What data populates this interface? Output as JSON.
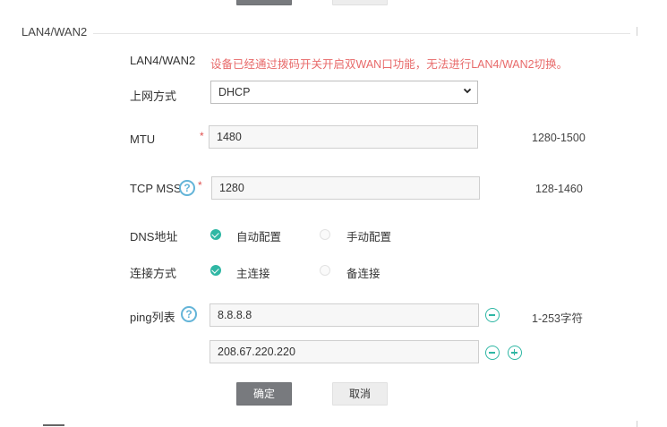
{
  "top_buttons": {
    "confirm_label": "",
    "cancel_label": ""
  },
  "section": {
    "title": "LAN4/WAN2"
  },
  "lan_wan": {
    "label": "LAN4/WAN2",
    "warning": "设备已经通过拨码开关开启双WAN口功能，无法进行LAN4/WAN2切换。"
  },
  "wan_mode": {
    "label": "上网方式",
    "value": "DHCP"
  },
  "mtu": {
    "label": "MTU",
    "required_mark": "*",
    "value": "1480",
    "range": "1280-1500"
  },
  "tcp_mss": {
    "label": "TCP MSS",
    "help_glyph": "?",
    "required_mark": "*",
    "value": "1280",
    "range": "128-1460"
  },
  "dns": {
    "label": "DNS地址",
    "options": [
      {
        "label": "自动配置",
        "selected": true
      },
      {
        "label": "手动配置",
        "selected": false
      }
    ]
  },
  "connection": {
    "label": "连接方式",
    "options": [
      {
        "label": "主连接",
        "selected": true
      },
      {
        "label": "备连接",
        "selected": false
      }
    ]
  },
  "ping_list": {
    "label": "ping列表",
    "help_glyph": "?",
    "entries": [
      "8.8.8.8",
      "208.67.220.220"
    ],
    "hint": "1-253字符"
  },
  "buttons": {
    "confirm_label": "确定",
    "cancel_label": "取消"
  },
  "colors": {
    "accent": "#2fb7a4",
    "help": "#63b4d8",
    "warning": "#e86a6a",
    "primary_button": "#787a7e"
  }
}
